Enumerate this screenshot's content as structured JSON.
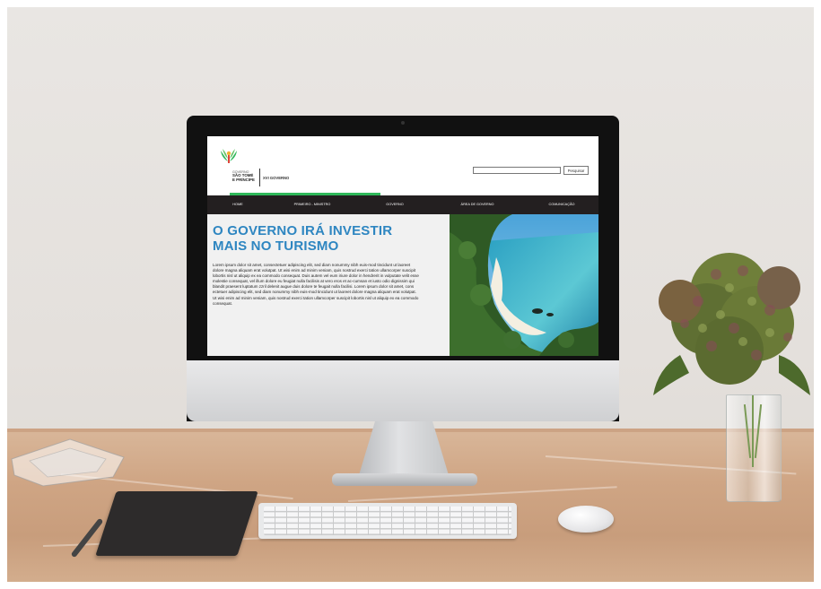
{
  "site": {
    "brand": {
      "line1": "GOVERNO",
      "line2": "SÃO TOMÉ",
      "line3": "E PRÍNCIPE",
      "government": "XVI GOVERNO"
    },
    "search": {
      "value": "",
      "button_label": "Pesquisar"
    },
    "nav": [
      {
        "label": "HOME"
      },
      {
        "label": "PRIMEIRO - MINISTRO"
      },
      {
        "label": "GOVERNO"
      },
      {
        "label": "ÁREA DE GOVERNO"
      },
      {
        "label": "COMUNICAÇÃO"
      }
    ],
    "hero": {
      "title_line1": "O GOVERNO IRÁ INVESTIR",
      "title_line2": "MAIS NO TURISMO",
      "body": "Lorem ipsum dolor sit amet, consectetuer adipiscing elit, sed diam nonummy nibh euis-mod tincidunt ut laoreet dolore magna aliquam erat volutpat. Ut wisi enim ad minim veniam, quis nostrud exerci tation ullamcorper suscipit lobortis nisl ut aliquip ex ea commodo consequat. Duis autem vel eum iriure dolor in hendrerit in vulputate velit esse molestie consequat, vel illum dolore eu feugiat nulla facilisis at vero eros et ac-cumsan et iusto odio dignissim qui blandit praesent luptatum zzril delenit augue duis dolore te feugait nulla facilisi. Lorem ipsum dolor sit amet, cons ectetuer adipiscing elit, sed diam nonummy nibh euis-mod tincidunt ut laoreet dolore magna aliquam erat volutpat. Ut wisi enim ad minim veniam, quis nostrud exerci tation ullamcorper suscipit lobortis nisl ut aliquip ex ea commodo consequat."
    },
    "colors": {
      "accent_green": "#2fb85a",
      "nav_bg": "#231f20",
      "title_blue": "#2e86c1"
    }
  }
}
